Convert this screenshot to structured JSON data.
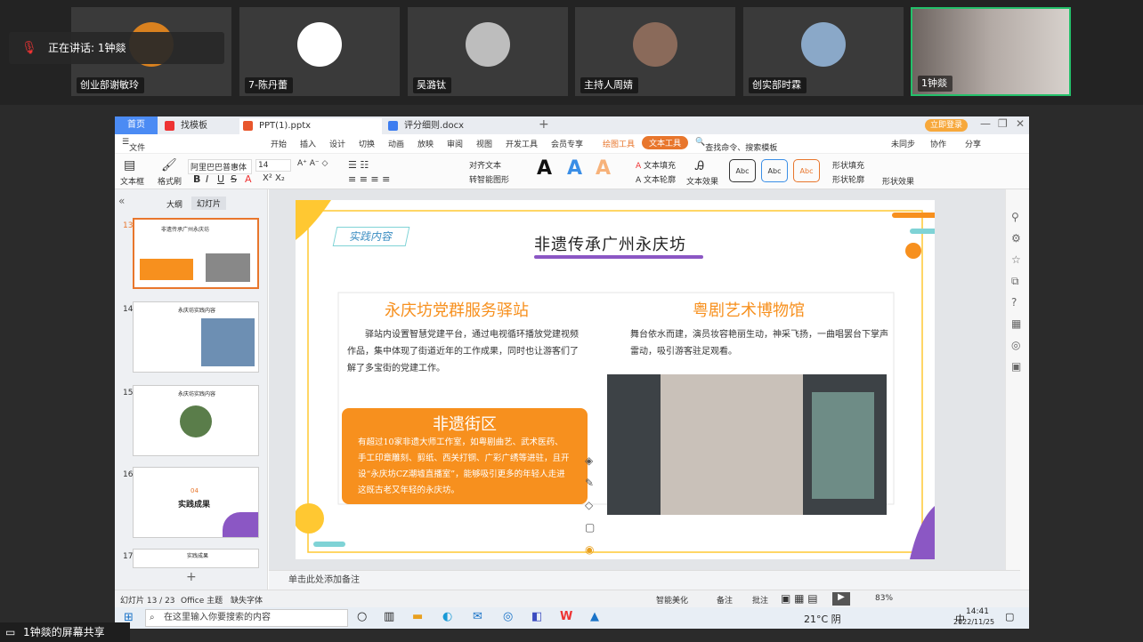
{
  "meeting": {
    "speaking_text": "正在讲话: 1钟燚",
    "participants": [
      {
        "name": "创业部谢敏玲",
        "color": "#d9811f"
      },
      {
        "name": "7-陈丹蕾",
        "color": "#ffffff"
      },
      {
        "name": "吴潞钛",
        "color": "#bfbfbf"
      },
      {
        "name": "主持人周婧",
        "color": "#8a6a5a"
      },
      {
        "name": "创实部时霖",
        "color": "#8aa8c8"
      },
      {
        "name": "1钟燚",
        "color": "#7a6a5e"
      }
    ],
    "screen_share_label": "1钟燚的屏幕共享"
  },
  "app": {
    "tabs": [
      "首页",
      "找模板",
      "PPT(1).pptx",
      "评分细则.docx"
    ],
    "login": "立即登录",
    "menu": [
      "文件",
      "开始",
      "插入",
      "设计",
      "切换",
      "动画",
      "放映",
      "审阅",
      "视图",
      "开发工具",
      "会员专享",
      "绘图工具",
      "文本工具"
    ],
    "search_placeholder": "查找命令、搜索模板",
    "right_menu": [
      "未同步",
      "协作",
      "分享"
    ],
    "toolbar": {
      "textbox": "文本框",
      "format_brush": "格式刷",
      "font": "阿里巴巴普惠体",
      "size": "14",
      "align_text": "对齐文本",
      "smart_art": "转智能图形",
      "text_fill": "文本填充",
      "text_outline": "文本轮廓",
      "text_effect": "文本效果",
      "shape_fill": "形状填充",
      "shape_outline": "形状轮廓",
      "shape_effect": "形状效果",
      "style_label": "Abc"
    },
    "panel_tabs": [
      "大纲",
      "幻灯片"
    ],
    "thumbs": [
      {
        "num": "13",
        "title": "非遗传承广州永庆坊"
      },
      {
        "num": "14",
        "title": "永庆坊实践内容"
      },
      {
        "num": "15",
        "title": "永庆坊实践内容"
      },
      {
        "num": "16",
        "title": "实践成果",
        "sub": "04"
      },
      {
        "num": "17",
        "title": "实践成果"
      }
    ],
    "notes_placeholder": "单击此处添加备注",
    "status": {
      "slide_count": "幻灯片 13 / 23",
      "theme": "Office 主题",
      "missing_font": "缺失字体",
      "smart_beautify": "智能美化",
      "notes": "备注",
      "comments": "批注",
      "zoom": "83%"
    }
  },
  "slide": {
    "tag": "实践内容",
    "title": "非遗传承广州永庆坊",
    "left_heading": "永庆坊党群服务驿站",
    "left_body": "驿站内设置智慧党建平台，通过电视循环播放党建视频作品，集中体现了街道近年的工作成果，同时也让游客们了解了多宝街的党建工作。",
    "right_heading": "粤剧艺术博物馆",
    "right_body": "舞台依水而建，演员妆容艳丽生动，神采飞扬，一曲唱罢台下掌声雷动，吸引游客驻足观看。",
    "box_heading": "非遗街区",
    "box_body": "有超过10家非遗大师工作室，如粤剧曲艺、武术医药、手工印章雕刻、剪纸、西关打铜、广彩广绣等进驻，且开设“永庆坊CZ潮墟直播室”，能够吸引更多的年轻人走进这既古老又年轻的永庆坊。",
    "colors": {
      "orange": "#f7901e",
      "purple": "#8b57c4",
      "teal": "#7fd3d6",
      "yellow": "#ffc832"
    }
  },
  "taskbar": {
    "search_placeholder": "在这里输入你要搜索的内容",
    "weather": "21°C 阴",
    "time": "14:41",
    "date": "2022/11/25",
    "ime": "中"
  }
}
